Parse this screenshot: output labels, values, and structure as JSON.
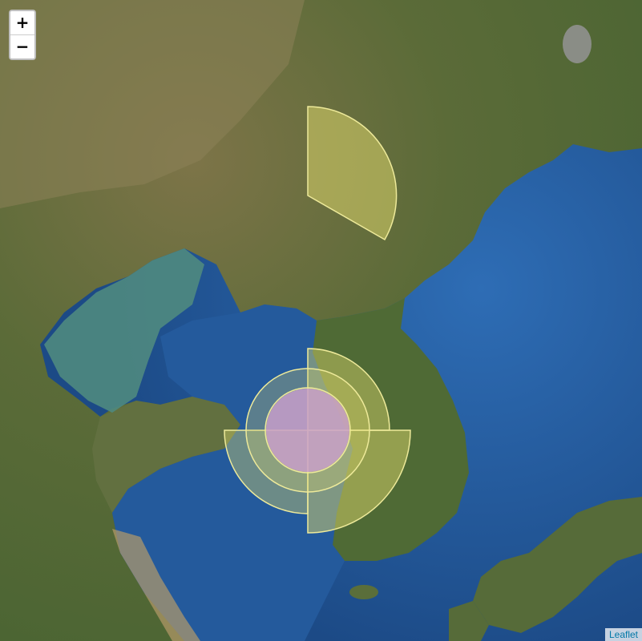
{
  "map": {
    "type": "satellite",
    "colors": {
      "land_base": "#5c6f3a",
      "land_dry": "#8f8457",
      "sea": "#1f4f8c",
      "shallow_sea": "#4f8b84",
      "sector_fill": "#d9d46a",
      "sector_stroke": "#eeea9a",
      "center_fill": "#c89ad6"
    }
  },
  "zoom_control": {
    "zoom_in_label": "+",
    "zoom_out_label": "−"
  },
  "attribution": {
    "text": "Leaflet"
  }
}
